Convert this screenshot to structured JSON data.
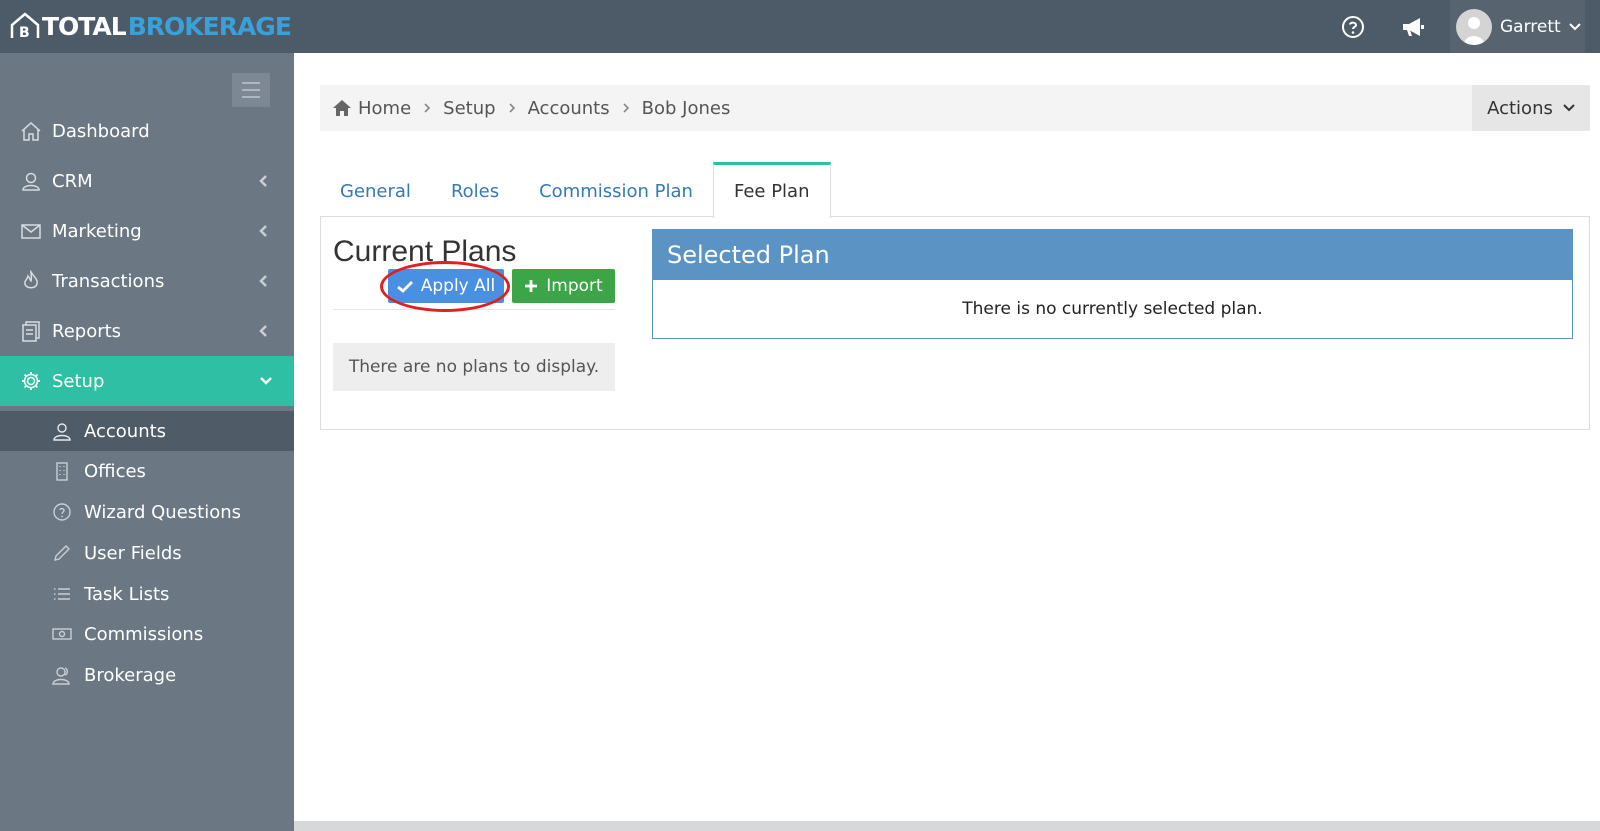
{
  "brand": {
    "part1": "TOTAL",
    "part2": "BROKERAGE"
  },
  "header": {
    "user_name": "Garrett"
  },
  "sidebar": {
    "items": [
      {
        "label": "Dashboard",
        "icon": "home-icon"
      },
      {
        "label": "CRM",
        "icon": "user-icon"
      },
      {
        "label": "Marketing",
        "icon": "envelope-icon"
      },
      {
        "label": "Transactions",
        "icon": "fire-icon"
      },
      {
        "label": "Reports",
        "icon": "report-icon"
      },
      {
        "label": "Setup",
        "icon": "gear-icon"
      }
    ],
    "sub_items": [
      {
        "label": "Accounts",
        "icon": "user-icon"
      },
      {
        "label": "Offices",
        "icon": "building-icon"
      },
      {
        "label": "Wizard Questions",
        "icon": "question-icon"
      },
      {
        "label": "User Fields",
        "icon": "pencil-icon"
      },
      {
        "label": "Task Lists",
        "icon": "list-icon"
      },
      {
        "label": "Commissions",
        "icon": "money-icon"
      },
      {
        "label": "Brokerage",
        "icon": "users-icon"
      }
    ]
  },
  "breadcrumb": {
    "items": [
      "Home",
      "Setup",
      "Accounts",
      "Bob Jones"
    ],
    "actions_label": "Actions"
  },
  "tabs": [
    "General",
    "Roles",
    "Commission Plan",
    "Fee Plan"
  ],
  "current_plans": {
    "title": "Current Plans",
    "apply_all_label": "Apply All",
    "import_label": "Import",
    "empty_message": "There are no plans to display."
  },
  "selected_plan": {
    "title": "Selected Plan",
    "empty_message": "There is no currently selected plan."
  },
  "colors": {
    "topbar": "#4d5a67",
    "sidebar": "#6b7783",
    "accent": "#2ebfa5",
    "primary": "#4a90e2",
    "success": "#3ca548",
    "panel": "#5b93c4"
  }
}
